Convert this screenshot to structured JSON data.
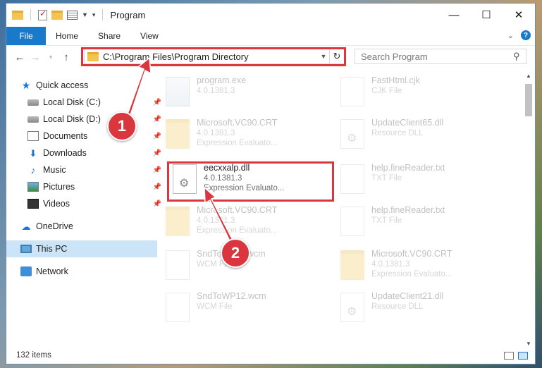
{
  "window": {
    "title": "Program",
    "controls": {
      "minimize": "—",
      "maximize": "☐",
      "close": "✕"
    }
  },
  "ribbon": {
    "file": "File",
    "tabs": [
      "Home",
      "Share",
      "View"
    ]
  },
  "address": {
    "path": "C:\\Program Files\\Program Directory"
  },
  "search": {
    "placeholder": "Search Program"
  },
  "sidebar": {
    "items": [
      {
        "label": "Quick access",
        "icon": "star-icon"
      },
      {
        "label": "Local Disk (C:)",
        "icon": "disk-icon"
      },
      {
        "label": "Local Disk (D:)",
        "icon": "disk-icon"
      },
      {
        "label": "Documents",
        "icon": "documents-icon"
      },
      {
        "label": "Downloads",
        "icon": "downloads-icon"
      },
      {
        "label": "Music",
        "icon": "music-icon"
      },
      {
        "label": "Pictures",
        "icon": "pictures-icon"
      },
      {
        "label": "Videos",
        "icon": "videos-icon"
      },
      {
        "label": "OneDrive",
        "icon": "onedrive-icon"
      },
      {
        "label": "This PC",
        "icon": "this-pc-icon"
      },
      {
        "label": "Network",
        "icon": "network-icon"
      }
    ]
  },
  "files": [
    {
      "name": "program.exe",
      "sub": "4.0.1381.3",
      "icon": "exe-icon"
    },
    {
      "name": "FastHtml.cjk",
      "sub": "CJK File",
      "icon": "file-icon"
    },
    {
      "name": "Microsoft.VC90.CRT",
      "sub": "4.0.1381.3",
      "sub2": "Expression Evaluato...",
      "icon": "folder-icon"
    },
    {
      "name": "UpdateClient65.dll",
      "sub": "Resource DLL",
      "icon": "dll-icon"
    },
    {
      "name": "eecxxalp.dll",
      "sub": "4.0.1381.3",
      "sub2": "Expression Evaluato...",
      "icon": "dll-icon"
    },
    {
      "name": "help.fineReader.txt",
      "sub": "TXT File",
      "icon": "file-icon"
    },
    {
      "name": "Microsoft.VC90.CRT",
      "sub": "4.0.1381.3",
      "sub2": "Expression Evaluato...",
      "icon": "folder-icon"
    },
    {
      "name": "help.fineReader.txt",
      "sub": "TXT File",
      "icon": "file-icon"
    },
    {
      "name": "SndToWP11.wcm",
      "sub": "WCM File",
      "icon": "file-icon"
    },
    {
      "name": "Microsoft.VC90.CRT",
      "sub": "4.0.1381.3",
      "sub2": "Expression Evaluato...",
      "icon": "folder-icon"
    },
    {
      "name": "SndToWP12.wcm",
      "sub": "WCM File",
      "icon": "file-icon"
    },
    {
      "name": "UpdateClient21.dll",
      "sub": "Resource DLL",
      "icon": "dll-icon"
    }
  ],
  "status": {
    "count": "132 items"
  },
  "callouts": {
    "one": "1",
    "two": "2"
  },
  "colors": {
    "accent": "#1979ca",
    "highlight": "#d9363e",
    "selected": "#cce4f7"
  }
}
